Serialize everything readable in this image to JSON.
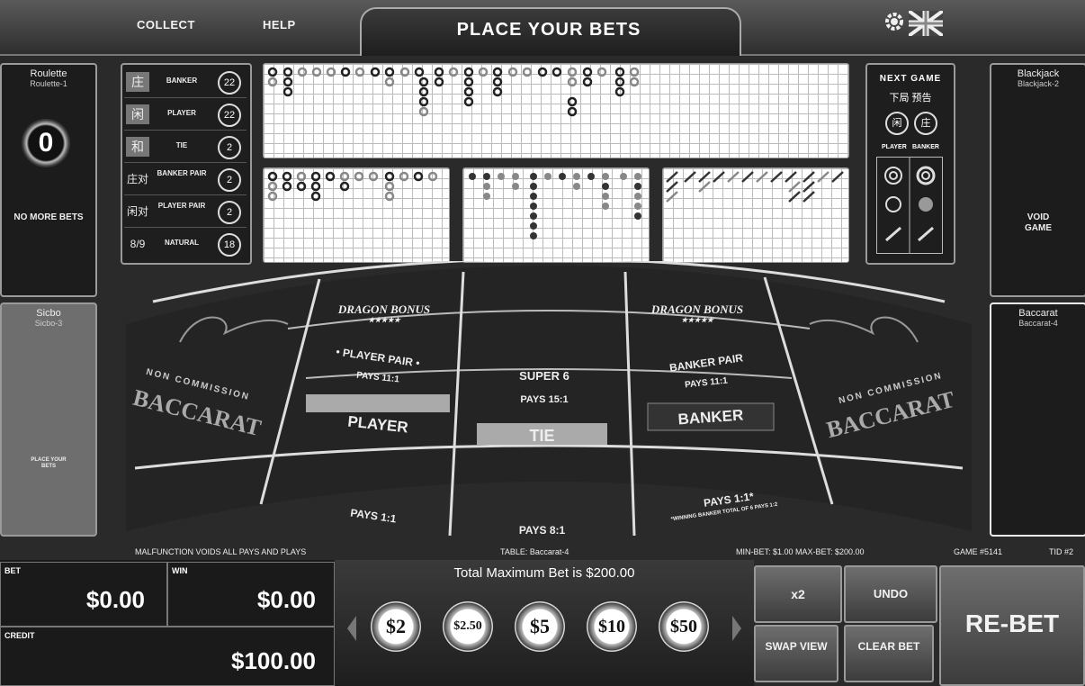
{
  "header": {
    "collect_label": "COLLECT",
    "help_label": "HELP",
    "title": "PLACE YOUR BETS"
  },
  "left_panels": [
    {
      "title": "Roulette",
      "subtitle": "Roulette-1",
      "number": "0",
      "status": "NO MORE BETS"
    },
    {
      "title": "Sicbo",
      "subtitle": "Sicbo-3",
      "status": "PLACE YOUR BETS"
    }
  ],
  "right_panels": [
    {
      "title": "Blackjack",
      "subtitle": "Blackjack-2",
      "status": "VOID GAME"
    },
    {
      "title": "Baccarat",
      "subtitle": "Baccarat-4"
    }
  ],
  "stats": [
    {
      "char": "庄",
      "label": "BANKER",
      "count": "22"
    },
    {
      "char": "闲",
      "label": "PLAYER",
      "count": "22"
    },
    {
      "char": "和",
      "label": "TIE",
      "count": "2"
    },
    {
      "char": "庄对",
      "label": "BANKER PAIR",
      "count": "2"
    },
    {
      "char": "闲对",
      "label": "PLAYER PAIR",
      "count": "2"
    },
    {
      "char": "8/9",
      "label": "NATURAL",
      "count": "18"
    }
  ],
  "next_game": {
    "title": "NEXT GAME",
    "subtitle": "下局 预告",
    "player_char": "闲",
    "banker_char": "庄",
    "player_label": "PLAYER",
    "banker_label": "BANKER"
  },
  "table": {
    "dragon_bonus": "DRAGON BONUS",
    "stars": "★★★★★",
    "player_pair": "• PLAYER PAIR •",
    "player_pair_pays": "PAYS 11:1",
    "super6": "SUPER 6",
    "super6_pays": "PAYS 15:1",
    "banker_pair": "BANKER PAIR",
    "banker_pair_pays": "PAYS 11:1",
    "player": "PLAYER",
    "player_pays": "PAYS 1:1",
    "tie": "TIE",
    "tie_pays": "PAYS 8:1",
    "banker": "BANKER",
    "banker_pays": "PAYS 1:1*",
    "banker_note": "*WINNING BANKER TOTAL OF 6 PAYS 1:2",
    "non_commission": "NON COMMISSION",
    "baccarat": "BACCARAT"
  },
  "footer": {
    "malfunction": "MALFUNCTION VOIDS ALL PAYS AND PLAYS",
    "table_name": "TABLE: Baccarat-4",
    "minmax": "MIN-BET: $1.00  MAX-BET: $200.00",
    "game_no": "GAME #5141",
    "tid": "TID #2",
    "max_bet": "Total Maximum Bet is $200.00"
  },
  "account": {
    "bet_label": "BET",
    "bet_value": "$0.00",
    "win_label": "WIN",
    "win_value": "$0.00",
    "credit_label": "CREDIT",
    "credit_value": "$100.00"
  },
  "chips": [
    "$2",
    "$2.50",
    "$5",
    "$10",
    "$50"
  ],
  "buttons": {
    "x2": "x2",
    "undo": "UNDO",
    "swap_view": "SWAP VIEW",
    "clear_bet": "CLEAR BET",
    "rebet": "RE-BET"
  }
}
